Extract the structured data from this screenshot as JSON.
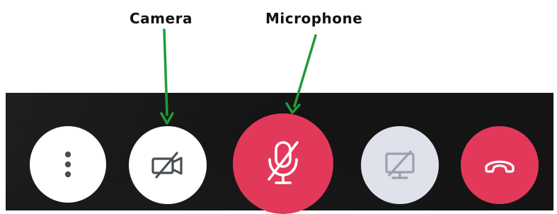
{
  "annotations": {
    "camera_label": "Camera",
    "microphone_label": "Microphone",
    "arrow_color": "#1f9d3a"
  },
  "controls": {
    "bar_background": "#141414",
    "buttons": [
      {
        "id": "more",
        "icon": "more-vertical-icon",
        "background": "#ffffff",
        "state": "default"
      },
      {
        "id": "camera",
        "icon": "camera-off-icon",
        "background": "#ffffff",
        "state": "off"
      },
      {
        "id": "microphone",
        "icon": "mic-off-icon",
        "background": "#e2395b",
        "state": "muted"
      },
      {
        "id": "screen-share",
        "icon": "screen-share-off-icon",
        "background": "#dfe2ea",
        "state": "disabled"
      },
      {
        "id": "hang-up",
        "icon": "phone-hangup-icon",
        "background": "#e2395b",
        "state": "default"
      }
    ]
  }
}
